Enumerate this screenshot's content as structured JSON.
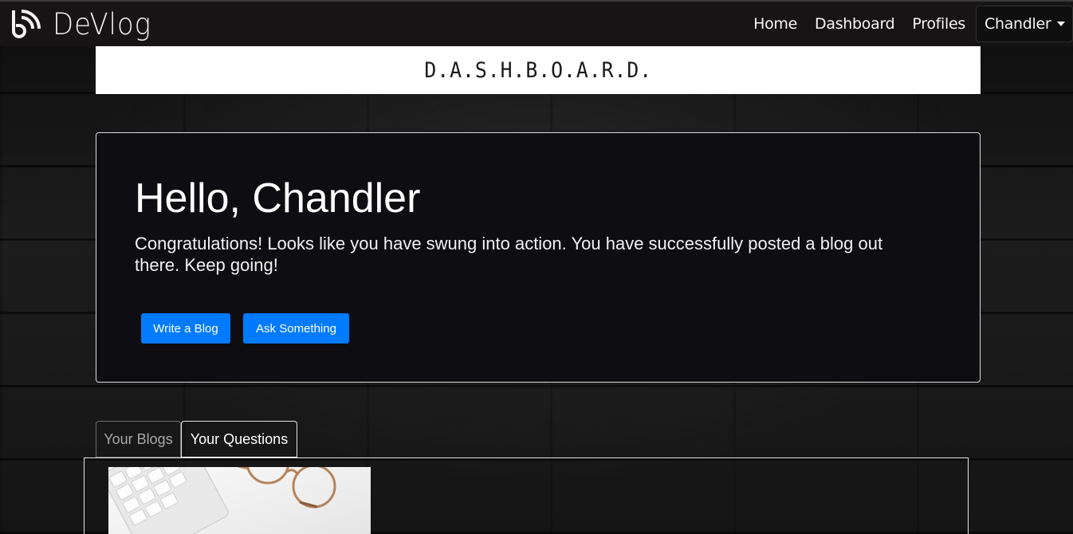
{
  "navbar": {
    "brand": "DeVlog",
    "links": [
      "Home",
      "Dashboard",
      "Profiles"
    ],
    "user_dropdown": "Chandler"
  },
  "banner": {
    "title": "D.A.S.H.B.O.A.R.D."
  },
  "jumbotron": {
    "greeting": "Hello, Chandler",
    "message": "Congratulations! Looks like you have swung into action. You have successfully posted a blog out there. Keep going!",
    "buttons": {
      "write": "Write a Blog",
      "ask": "Ask Something"
    }
  },
  "tabs": [
    "Your Blogs",
    "Your Questions"
  ],
  "colors": {
    "primary": "#007bff",
    "navbar_bg": "#161414",
    "jumbo_bg": "#0e0e12"
  }
}
